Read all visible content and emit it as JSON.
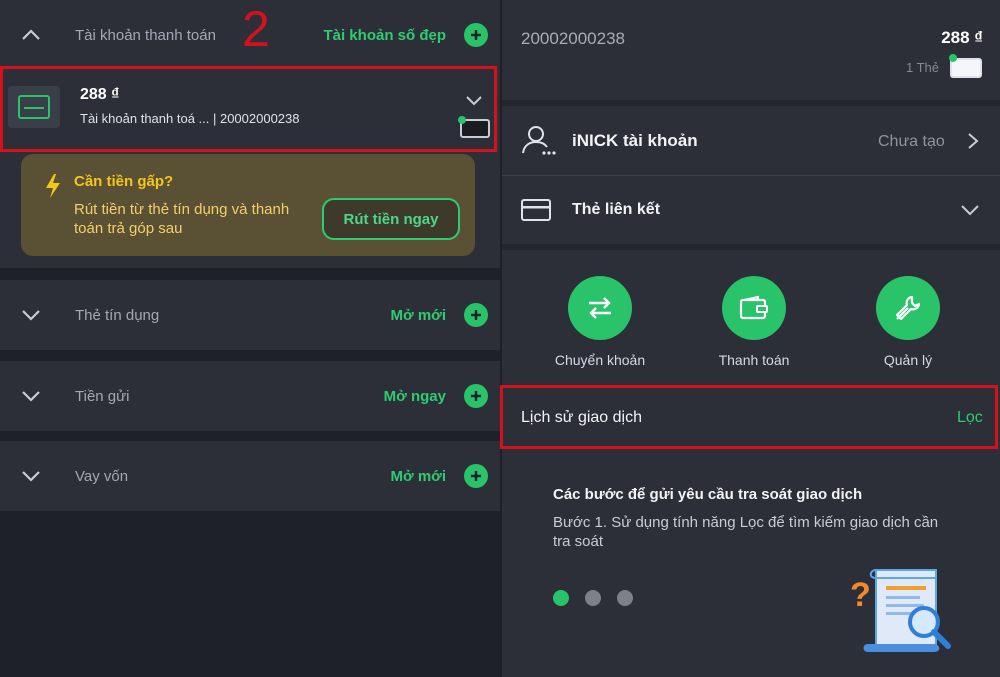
{
  "annotation_number": "2",
  "left": {
    "payment_section": {
      "title": "Tài khoản thanh toán",
      "action": "Tài khoản số đẹp",
      "account": {
        "amount": "288 ₫",
        "subtitle": "Tài khoản thanh toá ... | 20002000238"
      },
      "promo": {
        "title": "Cần tiền gấp?",
        "text": "Rút tiền từ thẻ tín dụng và thanh toán trả góp sau",
        "button": "Rút tiền ngay"
      }
    },
    "sections": [
      {
        "title": "Thẻ tín dụng",
        "action": "Mở mới"
      },
      {
        "title": "Tiền gửi",
        "action": "Mở ngay"
      },
      {
        "title": "Vay vốn",
        "action": "Mở mới"
      }
    ]
  },
  "right": {
    "account_number": "20002000238",
    "balance": "288 ₫",
    "card_count": "1 Thẻ",
    "inick": {
      "label": "iNICK tài khoản",
      "status": "Chưa tạo"
    },
    "linked_card": {
      "label": "Thẻ liên kết"
    },
    "actions": [
      {
        "label": "Chuyển khoản",
        "icon": "transfer-icon"
      },
      {
        "label": "Thanh toán",
        "icon": "wallet-icon"
      },
      {
        "label": "Quản lý",
        "icon": "wrench-icon"
      }
    ],
    "history": {
      "label": "Lịch sử giao dịch",
      "filter": "Lọc"
    },
    "tip": {
      "title": "Các bước để gửi yêu cầu tra soát giao dịch",
      "text": "Bước 1. Sử dụng tính năng Lọc để tìm kiếm giao dịch cần tra soát"
    }
  },
  "colors": {
    "accent_green": "#29c36a",
    "annotation_red": "#d3121c",
    "promo_bg": "#5a5135",
    "promo_text": "#f3cf6b"
  }
}
